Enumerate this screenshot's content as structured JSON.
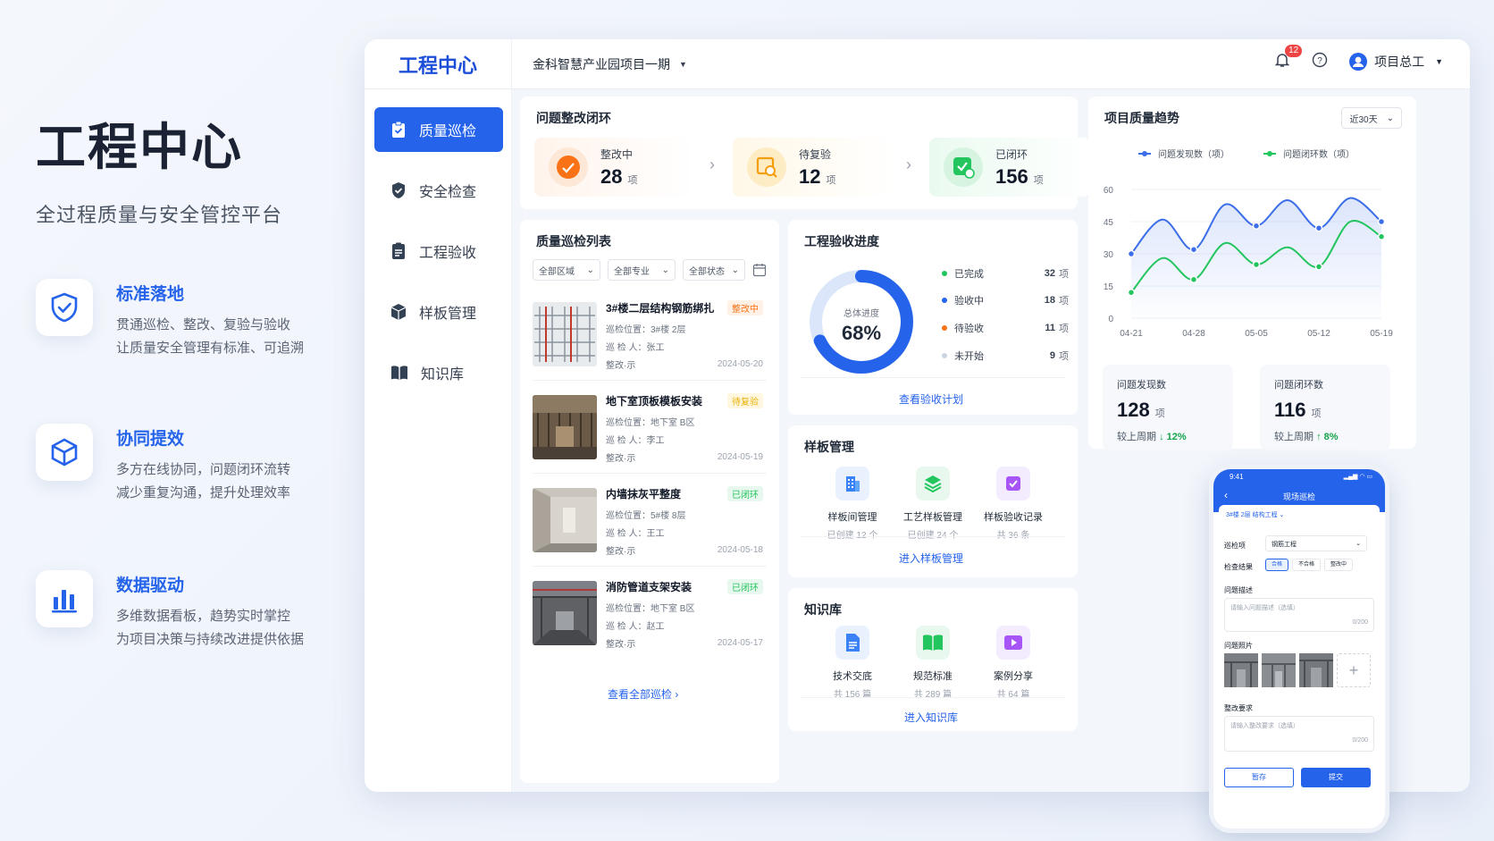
{
  "hero": {
    "title": "工程中心",
    "subtitle": "全过程质量与安全管控平台"
  },
  "features": [
    {
      "icon": "shield-check-icon",
      "title": "标准落地",
      "line1": "贯通巡检、整改、复验与验收",
      "line2": "让质量安全管理有标准、可追溯"
    },
    {
      "icon": "cube-icon",
      "title": "协同提效",
      "line1": "多方在线协同，问题闭环流转",
      "line2": "减少重复沟通，提升处理效率"
    },
    {
      "icon": "bar-chart-icon",
      "title": "数据驱动",
      "line1": "多维数据看板，趋势实时掌控",
      "line2": "为项目决策与持续改进提供依据"
    }
  ],
  "app": {
    "brand": "工程中心",
    "project": "金科智慧产业园项目一期",
    "notifications": "12",
    "user": "项目总工"
  },
  "sidebar": {
    "items": [
      {
        "label": "质量巡检",
        "icon": "clipboard-check-icon"
      },
      {
        "label": "安全检查",
        "icon": "shield-icon"
      },
      {
        "label": "工程验收",
        "icon": "document-icon"
      },
      {
        "label": "样板管理",
        "icon": "box-icon"
      },
      {
        "label": "知识库",
        "icon": "book-icon"
      }
    ]
  },
  "closure": {
    "title": "问题整改闭环",
    "stages": [
      {
        "label": "整改中",
        "count": "28",
        "unit": "项",
        "color": "#f97316"
      },
      {
        "label": "待复验",
        "count": "12",
        "unit": "项",
        "color": "#f59e0b"
      },
      {
        "label": "已闭环",
        "count": "156",
        "unit": "项",
        "color": "#22c55e"
      }
    ]
  },
  "inspection": {
    "title": "质量巡检列表",
    "filters": [
      "全部区域",
      "全部专业",
      "全部状态"
    ],
    "items": [
      {
        "title": "3#楼二层结构钢筋绑扎",
        "tag": "整改中",
        "location": "巡检位置：3#楼 2层",
        "inspector": "巡 检 人：张工",
        "extra": "整改·示",
        "date": "2024-05-20"
      },
      {
        "title": "地下室顶板模板安装",
        "tag": "待复验",
        "location": "巡检位置：地下室 B区",
        "inspector": "巡 检 人：李工",
        "extra": "整改·示",
        "date": "2024-05-19"
      },
      {
        "title": "内墙抹灰平整度",
        "tag": "已闭环",
        "location": "巡检位置：5#楼 8层",
        "inspector": "巡 检 人：王工",
        "extra": "整改·示",
        "date": "2024-05-18"
      },
      {
        "title": "消防管道支架安装",
        "tag": "已闭环",
        "location": "巡检位置：地下室 B区",
        "inspector": "巡 检 人：赵工",
        "extra": "整改·示",
        "date": "2024-05-17"
      }
    ],
    "view_all": "查看全部巡检"
  },
  "acceptance": {
    "title": "工程验收进度",
    "ring_label": "总体进度",
    "ring_value": "68%",
    "progress": 0.68,
    "legend": [
      {
        "label": "已完成",
        "count": "32",
        "unit": "项",
        "color": "#22c55e"
      },
      {
        "label": "验收中",
        "count": "18",
        "unit": "项",
        "color": "#2563eb"
      },
      {
        "label": "待验收",
        "count": "11",
        "unit": "项",
        "color": "#f97316"
      },
      {
        "label": "未开始",
        "count": "9",
        "unit": "项",
        "color": "#cbd5e1"
      }
    ],
    "link": "查看验收计划"
  },
  "samples": {
    "title": "样板管理",
    "tiles": [
      {
        "name": "样板间管理",
        "count": "已创建 12 个",
        "icon": "building-icon",
        "color": "#3b82f6"
      },
      {
        "name": "工艺样板管理",
        "count": "已创建 24 个",
        "icon": "layers-icon",
        "color": "#22c55e"
      },
      {
        "name": "样板验收记录",
        "count": "共 36 条",
        "icon": "checklist-icon",
        "color": "#a855f7"
      }
    ],
    "link": "进入样板管理"
  },
  "knowledge": {
    "title": "知识库",
    "tiles": [
      {
        "name": "技术交底",
        "count": "共 156 篇",
        "icon": "file-icon",
        "color": "#3b82f6"
      },
      {
        "name": "规范标准",
        "count": "共 289 篇",
        "icon": "open-book-icon",
        "color": "#22c55e"
      },
      {
        "name": "案例分享",
        "count": "共 64 篇",
        "icon": "play-icon",
        "color": "#a855f7"
      }
    ],
    "link": "进入知识库"
  },
  "trend": {
    "title": "项目质量趋势",
    "range": "近30天",
    "stats": [
      {
        "label": "问题发现数",
        "value": "128",
        "unit": "项",
        "compare": "较上周期",
        "delta": "↓ 12%",
        "color": "#16a34a"
      },
      {
        "label": "问题闭环数",
        "value": "116",
        "unit": "项",
        "compare": "较上周期",
        "delta": "↑ 8%",
        "color": "#16a34a"
      }
    ]
  },
  "chart_data": {
    "type": "line",
    "x": [
      "04-21",
      "04-24",
      "04-28",
      "05-01",
      "05-05",
      "05-08",
      "05-12",
      "05-15",
      "05-19"
    ],
    "xticks": [
      "04-21",
      "04-28",
      "05-05",
      "05-12",
      "05-19"
    ],
    "ylim": [
      0,
      60
    ],
    "yticks": [
      "0",
      "15",
      "30",
      "45",
      "60"
    ],
    "legend_position": "top",
    "series": [
      {
        "name": "问题发现数（项）",
        "color": "#3b6ee8",
        "values": [
          30,
          46,
          32,
          53,
          43,
          55,
          42,
          56,
          45
        ]
      },
      {
        "name": "问题闭环数（项）",
        "color": "#22c55e",
        "values": [
          12,
          28,
          18,
          35,
          25,
          33,
          24,
          45,
          38
        ]
      }
    ]
  },
  "phone": {
    "time": "9:41",
    "title": "现场巡检",
    "context": "3#楼 2层 结构工程",
    "item_label": "巡检项",
    "item_value": "钢筋工程",
    "result_label": "检查结果",
    "results": [
      "合格",
      "不合格",
      "整改中"
    ],
    "desc_label": "问题描述",
    "desc_placeholder": "请输入问题描述（选填）",
    "desc_count": "0/200",
    "photo_label": "问题照片",
    "req_label": "整改要求",
    "req_placeholder": "请输入整改要求（选填）",
    "req_count": "0/200",
    "save": "暂存",
    "submit": "提交"
  }
}
